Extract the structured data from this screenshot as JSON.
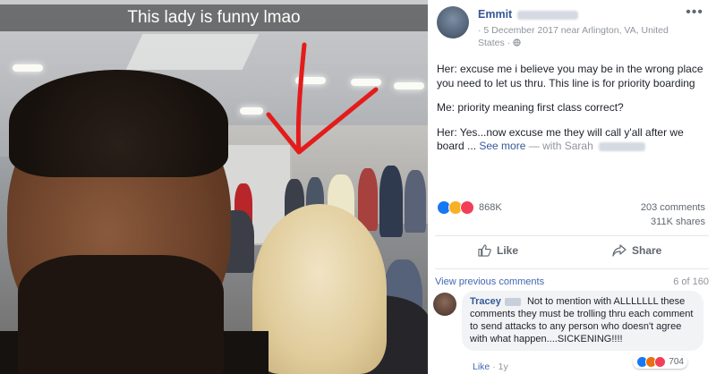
{
  "photo": {
    "caption": "This lady is funny lmao",
    "colors": {
      "arrow": "#e41b1b",
      "caption_bg": "#000000"
    }
  },
  "post": {
    "author": "Emmit",
    "meta": "· 5 December 2017 near Arlington, VA, United States ·",
    "more_icon": "more-dots-icon",
    "body": {
      "para1": "Her: excuse me i believe you may be in the wrong place you need to let us thru. This line is for priority boarding",
      "para2": "Me: priority meaning first class correct?",
      "para3": "Her: Yes...now excuse me they will call y'all after we board ...",
      "see_more": "See more",
      "with": "— with Sarah"
    },
    "reactions": {
      "count": "868K",
      "icons": [
        "like-reaction-icon",
        "haha-reaction-icon",
        "love-reaction-icon"
      ]
    },
    "stats": {
      "comments": "203 comments",
      "shares": "311K shares"
    },
    "actions": {
      "like": "Like",
      "share": "Share"
    },
    "comments_header": {
      "view_previous": "View previous comments",
      "page": "6 of 160"
    },
    "comment": {
      "name": "Tracey",
      "text": "Not to mention with ALLLLLLL these comments they must be trolling thru each comment to send attacks to any person who doesn't agree with what happen....SICKENING!!!!",
      "reaction_count": "704",
      "like": "Like",
      "time": "1y"
    },
    "colors": {
      "link": "#365899",
      "accent": "#4267b2",
      "muted": "#90949c"
    }
  }
}
